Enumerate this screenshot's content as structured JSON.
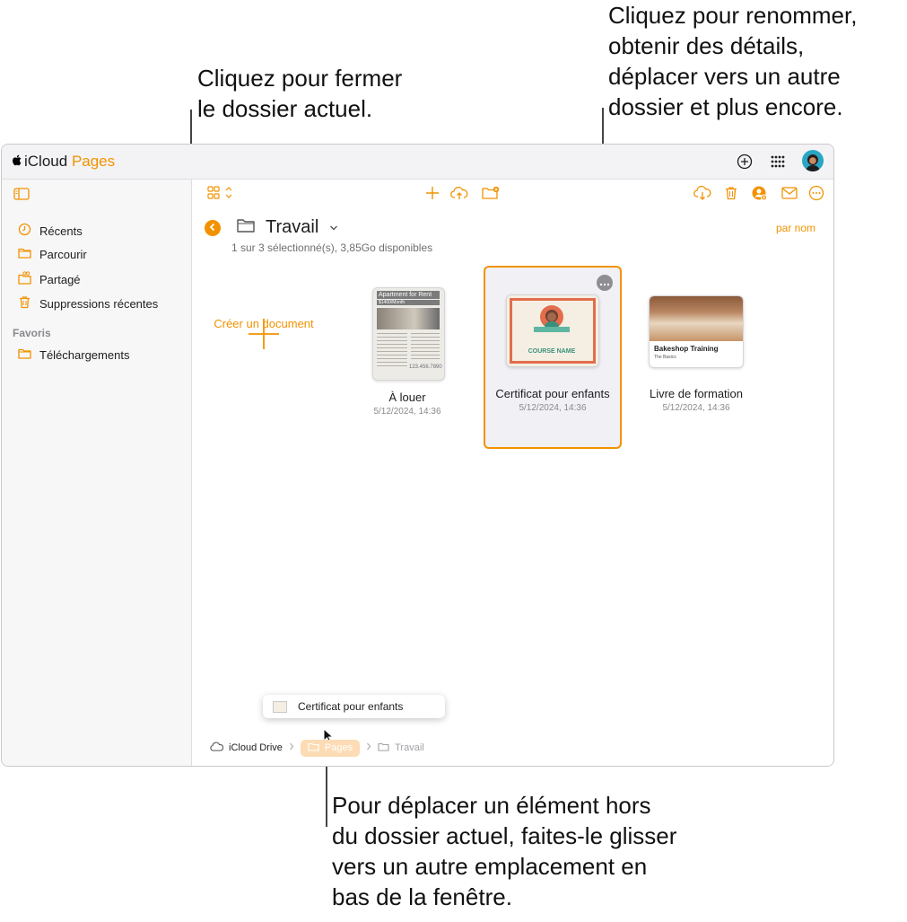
{
  "callouts": {
    "close_folder": [
      "Cliquez pour fermer",
      "le dossier actuel."
    ],
    "more_menu": [
      "Cliquez pour renommer,",
      "obtenir des détails,",
      "déplacer vers un autre",
      "dossier et plus encore."
    ],
    "drag_out": [
      "Pour déplacer un élément hors",
      "du dossier actuel, faites-le glisser",
      "vers un autre emplacement en",
      "bas de la fenêtre."
    ]
  },
  "app": {
    "apple": "",
    "cloud": "iCloud",
    "name": "Pages"
  },
  "sidebar": {
    "items": [
      {
        "label": "Récents",
        "icon": "clock-icon"
      },
      {
        "label": "Parcourir",
        "icon": "folder-icon"
      },
      {
        "label": "Partagé",
        "icon": "shared-folder-icon"
      },
      {
        "label": "Suppressions récentes",
        "icon": "trash-icon"
      }
    ],
    "favorites_title": "Favoris",
    "favorites": [
      {
        "label": "Téléchargements",
        "icon": "folder-icon"
      }
    ]
  },
  "folder": {
    "title": "Travail",
    "status": "1 sur 3 sélectionné(s), 3,85Go disponibles",
    "sort": "par nom"
  },
  "create": {
    "label": "Créer un document"
  },
  "documents": [
    {
      "name": "À louer",
      "date": "5/12/2024, 14:36",
      "thumb_title": "Apartment for Rent",
      "thumb_sub": "$1400/Month",
      "thumb_phone": "123.456.7890"
    },
    {
      "name": "Certificat pour enfants",
      "date": "5/12/2024, 14:36",
      "thumb_title": "COURSE NAME",
      "selected": true
    },
    {
      "name": "Livre de formation",
      "date": "5/12/2024, 14:36",
      "thumb_title": "Bakeshop Training",
      "thumb_sub": "The Basics"
    }
  ],
  "drag": {
    "label": "Certificat pour enfants"
  },
  "breadcrumb": [
    {
      "label": "iCloud Drive"
    },
    {
      "label": "Pages"
    },
    {
      "label": "Travail"
    }
  ],
  "colors": {
    "accent": "#f29200",
    "selection": "#f0f0f5"
  }
}
